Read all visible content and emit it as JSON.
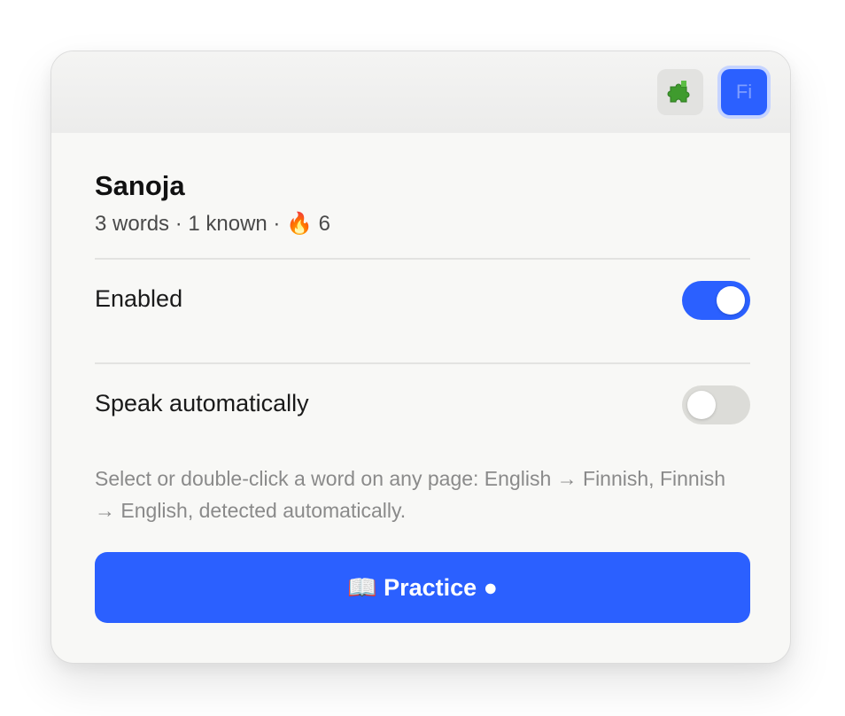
{
  "header": {
    "extensions_icon": "puzzle-piece-icon",
    "language_button_label": "Fi"
  },
  "deck": {
    "title": "Sanoja",
    "stats": "3 words · 1 known · 🔥 6"
  },
  "settings": {
    "enabled_label": "Enabled",
    "enabled_state": true,
    "speak_label": "Speak automatically",
    "speak_state": false
  },
  "help_text": "Select or double-click a word on any page: English → Finnish, Finnish → English, detected automatically.",
  "practice_button_label": "📖 Practice ●",
  "colors": {
    "accent": "#2b60ff",
    "toggle_off": "#dcdcd8",
    "background": "#f8f8f6",
    "help_text": "#8a8a8a"
  }
}
